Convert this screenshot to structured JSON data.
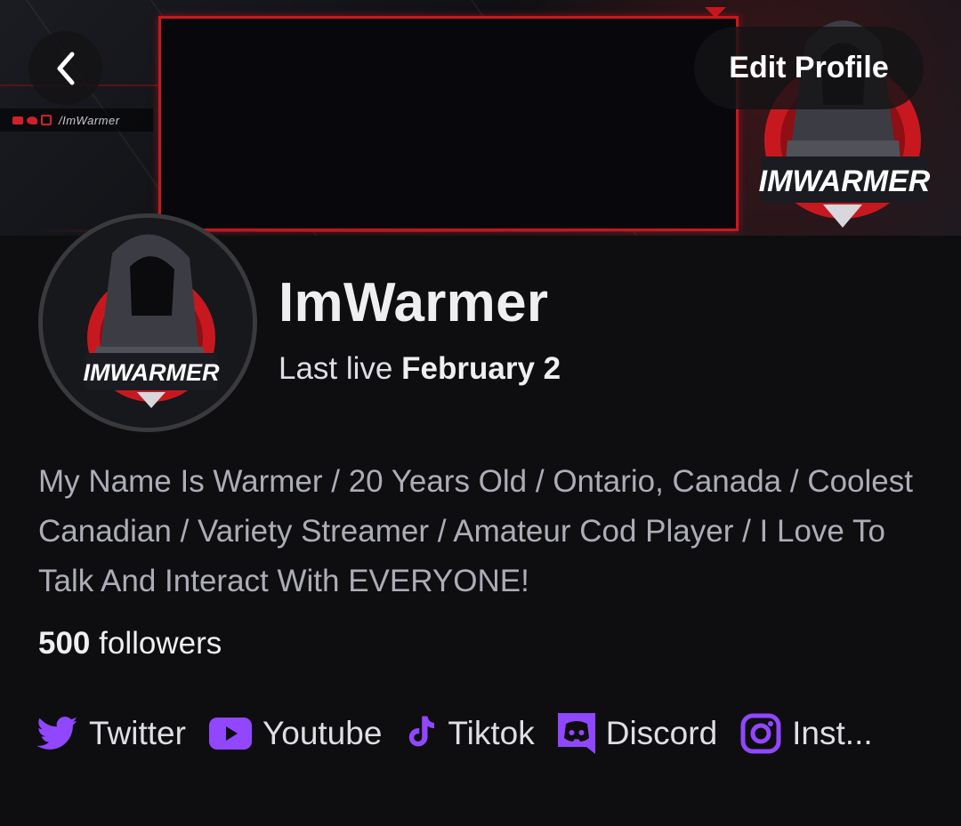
{
  "banner": {
    "social_handle": "/ImWarmer",
    "logo_text": "IMWARMER",
    "accent_color": "#c8181f"
  },
  "header": {
    "back_icon": "chevron-left-icon",
    "edit_label": "Edit Profile"
  },
  "profile": {
    "avatar_text": "IMWARMER",
    "name": "ImWarmer",
    "last_live_prefix": "Last live",
    "last_live_date": "February 2",
    "bio": "My Name Is Warmer / 20 Years Old / Ontario, Canada / Coolest Canadian / Variety Streamer / Amateur Cod Player / I Love To Talk And Interact With EVERYONE!",
    "followers_count": "500",
    "followers_label": "followers"
  },
  "links": [
    {
      "icon": "twitter-icon",
      "label": "Twitter"
    },
    {
      "icon": "youtube-icon",
      "label": "Youtube"
    },
    {
      "icon": "tiktok-icon",
      "label": "Tiktok"
    },
    {
      "icon": "discord-icon",
      "label": "Discord"
    },
    {
      "icon": "instagram-icon",
      "label": "Inst..."
    }
  ],
  "colors": {
    "background": "#0e0e10",
    "link_icon": "#9147ff",
    "bio_text": "#adadb8"
  }
}
